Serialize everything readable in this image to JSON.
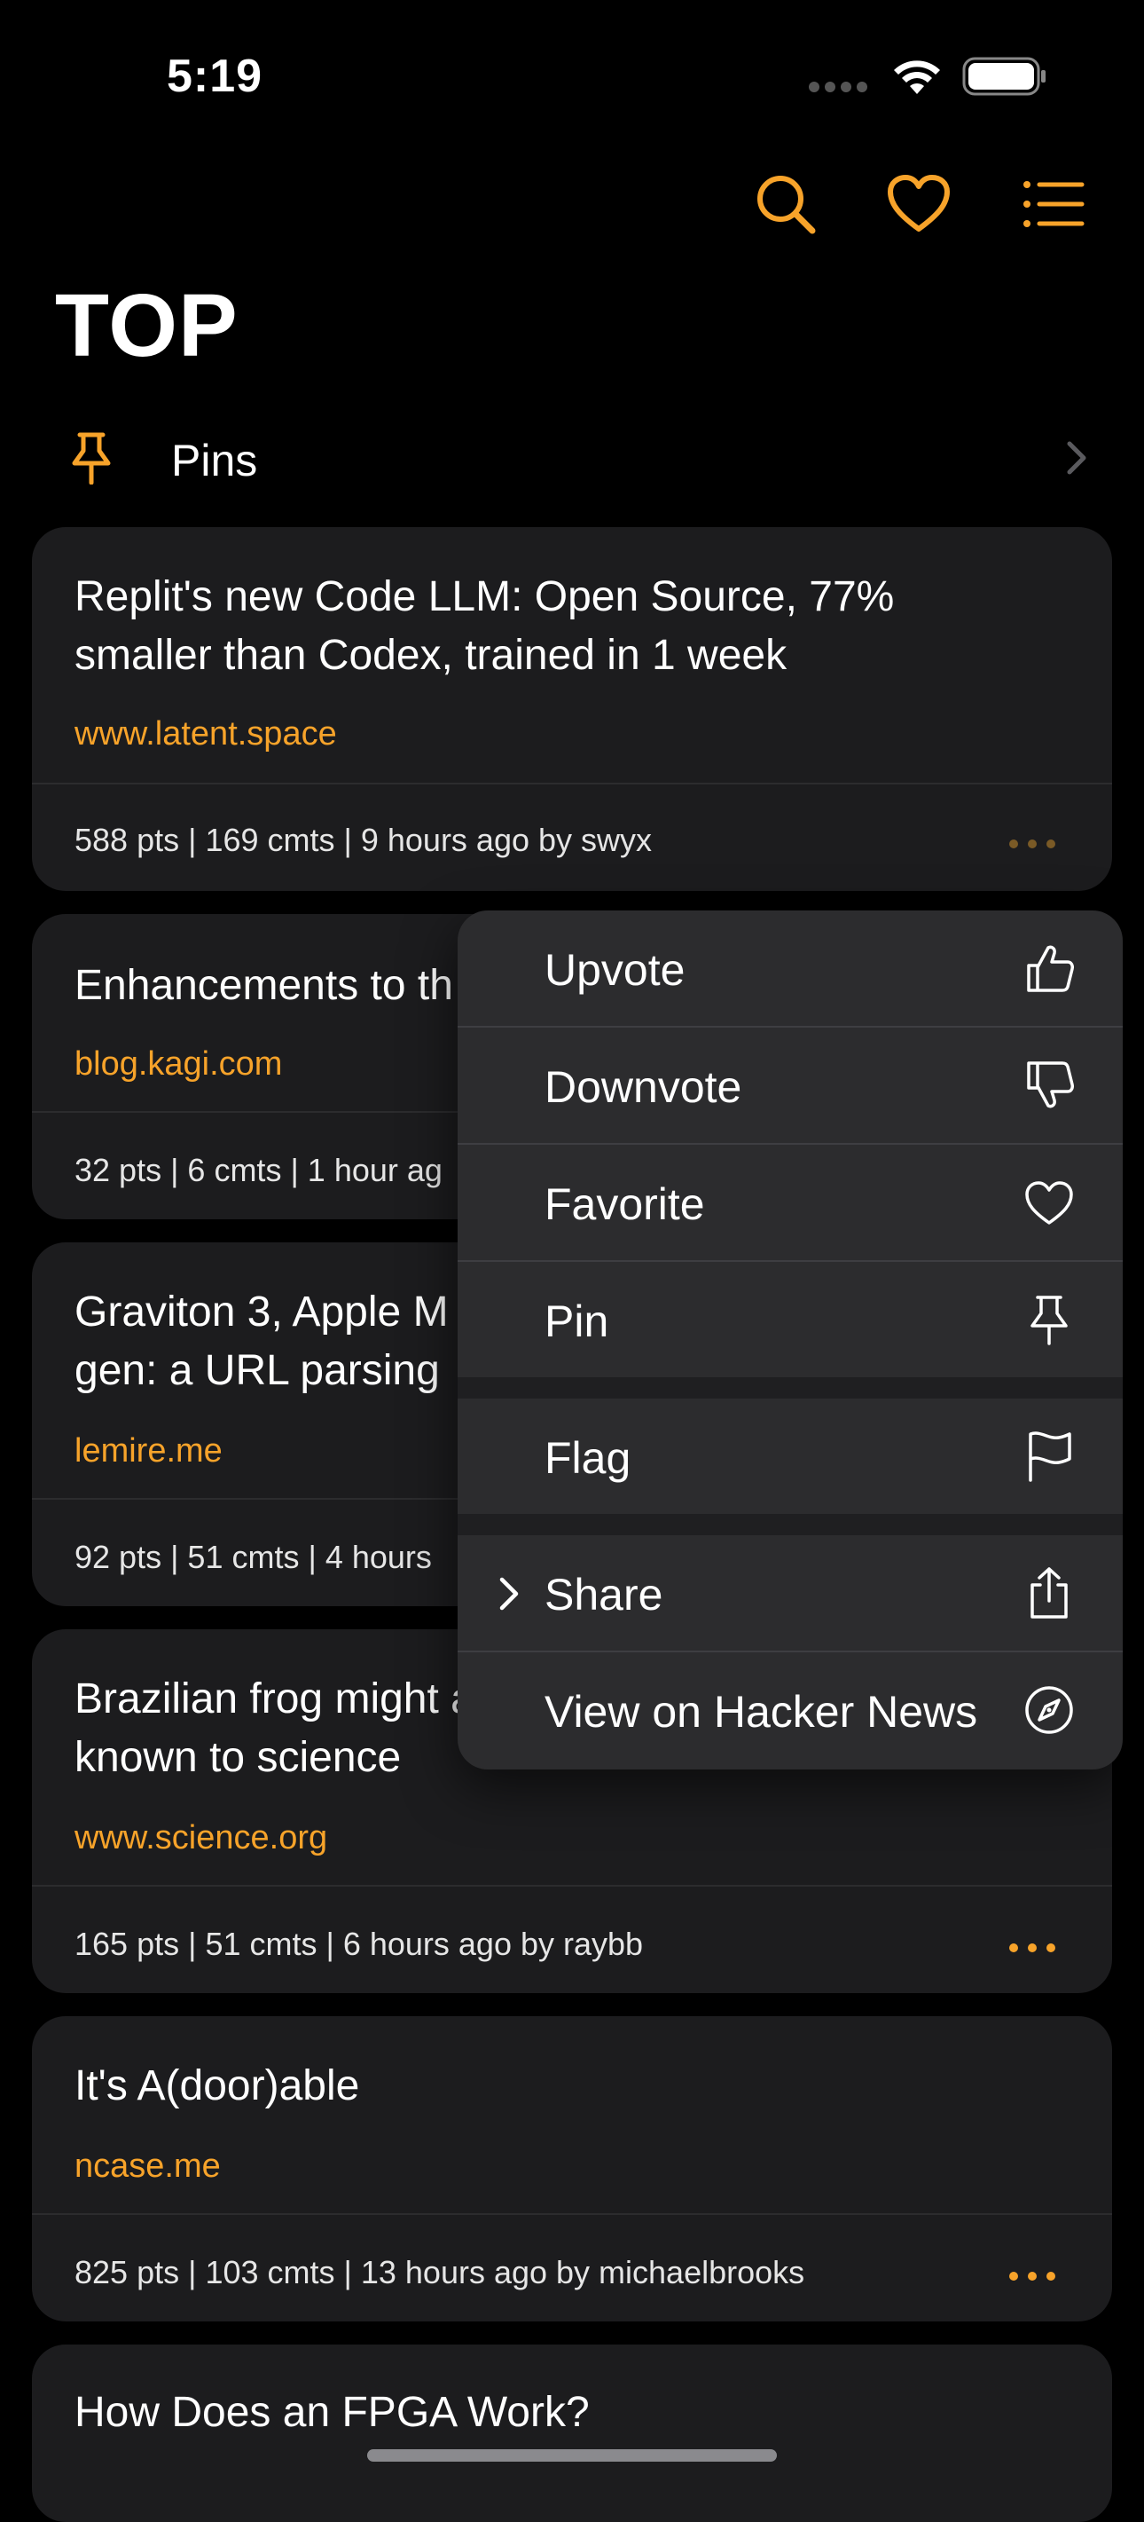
{
  "status_bar": {
    "time": "5:19"
  },
  "toolbar": {
    "icons": [
      "search-icon",
      "heart-icon",
      "list-icon"
    ],
    "accent": "#f7a32a"
  },
  "page_title": "TOP",
  "pins": {
    "label": "Pins"
  },
  "stories": [
    {
      "title": "Replit's new Code LLM: Open Source, 77% smaller than Codex, trained in 1 week",
      "domain": "www.latent.space",
      "meta": "588 pts | 169 cmts | 9 hours ago by swyx"
    },
    {
      "title": "Enhancements to th",
      "domain": "blog.kagi.com",
      "meta": "32 pts | 6 cmts | 1 hour ag"
    },
    {
      "title": "Graviton 3, Apple M gen: a URL parsing",
      "domain": "lemire.me",
      "meta": "92 pts | 51 cmts | 4 hours"
    },
    {
      "title": "Brazilian frog might amphibian known to science",
      "domain": "www.science.org",
      "meta": "165 pts | 51 cmts | 6 hours ago by raybb"
    },
    {
      "title": "It's A(door)able",
      "domain": "ncase.me",
      "meta": "825 pts | 103 cmts | 13 hours ago by michaelbrooks"
    },
    {
      "title": "How Does an FPGA Work?",
      "domain": "",
      "meta": ""
    }
  ],
  "context_menu": {
    "items": [
      {
        "label": "Upvote",
        "icon": "thumbs-up-icon"
      },
      {
        "label": "Downvote",
        "icon": "thumbs-down-icon"
      },
      {
        "label": "Favorite",
        "icon": "heart-icon"
      },
      {
        "label": "Pin",
        "icon": "pin-icon"
      },
      {
        "label": "Flag",
        "icon": "flag-icon"
      },
      {
        "label": "Share",
        "icon": "share-icon"
      },
      {
        "label": "View on Hacker News",
        "icon": "compass-icon"
      }
    ]
  }
}
